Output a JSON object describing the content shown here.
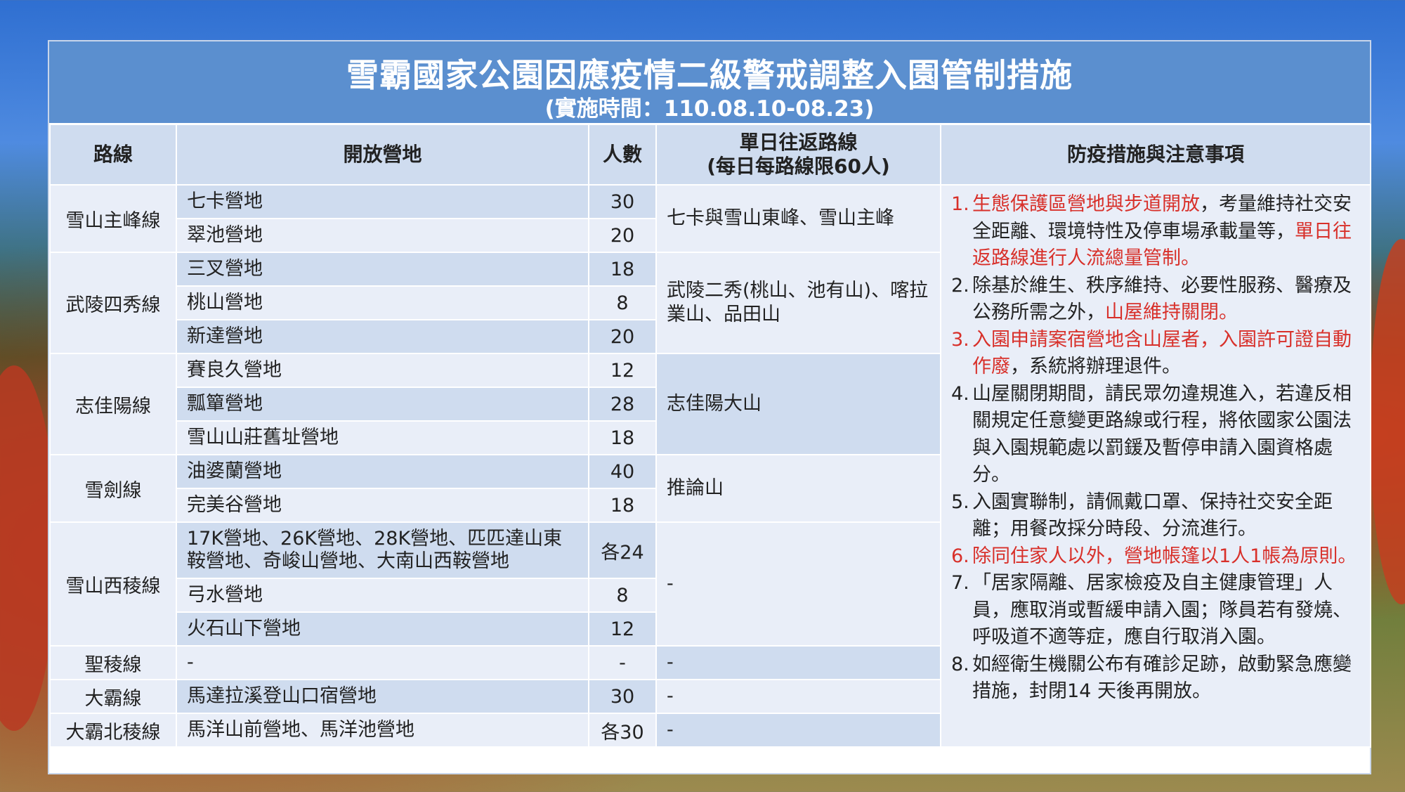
{
  "header": {
    "title": "雪霸國家公園因應疫情二級警戒調整入園管制措施",
    "subtitle": "(實施時間：110.08.10-08.23)"
  },
  "columns": {
    "route": "路線",
    "camp": "開放營地",
    "count": "人數",
    "trail_line1": "單日往返路線",
    "trail_line2": "(每日每路線限60人)",
    "notes": "防疫措施與注意事項"
  },
  "routes": [
    {
      "name": "雪山主峰線",
      "trail": "七卡與雪山東峰、雪山主峰",
      "camps": [
        {
          "name": "七卡營地",
          "count": "30"
        },
        {
          "name": "翠池營地",
          "count": "20"
        }
      ]
    },
    {
      "name": "武陵四秀線",
      "trail": "武陵二秀(桃山、池有山)、喀拉業山、品田山",
      "camps": [
        {
          "name": "三叉營地",
          "count": "18"
        },
        {
          "name": "桃山營地",
          "count": "8"
        },
        {
          "name": "新達營地",
          "count": "20"
        }
      ]
    },
    {
      "name": "志佳陽線",
      "trail": "志佳陽大山",
      "camps": [
        {
          "name": "賽良久營地",
          "count": "12"
        },
        {
          "name": "瓢簞營地",
          "count": "28"
        },
        {
          "name": "雪山山莊舊址營地",
          "count": "18"
        }
      ]
    },
    {
      "name": "雪劍線",
      "trail": "推論山",
      "camps": [
        {
          "name": "油婆蘭營地",
          "count": "40"
        },
        {
          "name": "完美谷營地",
          "count": "18"
        }
      ]
    },
    {
      "name": "雪山西稜線",
      "trail": "-",
      "camps": [
        {
          "name": "17K營地、26K營地、28K營地、匹匹達山東鞍營地、奇峻山營地、大南山西鞍營地",
          "count": "各24"
        },
        {
          "name": "弓水營地",
          "count": "8"
        },
        {
          "name": "火石山下營地",
          "count": "12"
        }
      ]
    },
    {
      "name": "聖稜線",
      "trail": "-",
      "camps": [
        {
          "name": "-",
          "count": "-"
        }
      ]
    },
    {
      "name": "大霸線",
      "trail": "-",
      "camps": [
        {
          "name": "馬達拉溪登山口宿營地",
          "count": "30"
        }
      ]
    },
    {
      "name": "大霸北稜線",
      "trail": "-",
      "camps": [
        {
          "name": "馬洋山前營地、馬洋池營地",
          "count": "各30"
        }
      ]
    }
  ],
  "notes": [
    {
      "num": "1.",
      "parts": [
        {
          "text": "生態保護區營地與步道開放",
          "red": true
        },
        {
          "text": "，考量維持社交安全距離、環境特性及停車場承載量等，",
          "red": false
        },
        {
          "text": "單日往返路線進行人流總量管制。",
          "red": true
        }
      ]
    },
    {
      "num": "2.",
      "parts": [
        {
          "text": "除基於維生、秩序維持、必要性服務、醫療及公務所需之外，",
          "red": false
        },
        {
          "text": "山屋維持關閉。",
          "red": true
        }
      ]
    },
    {
      "num": "3.",
      "parts": [
        {
          "text": "入園申請案宿營地含山屋者，入園許可證自動作廢",
          "red": true
        },
        {
          "text": "，系統將辦理退件。",
          "red": false
        }
      ]
    },
    {
      "num": "4.",
      "parts": [
        {
          "text": "山屋關閉期間，請民眾勿違規進入，若違反相關規定任意變更路線或行程，將依國家公園法與入園規範處以罰鍰及暫停申請入園資格處分。",
          "red": false
        }
      ]
    },
    {
      "num": "5.",
      "parts": [
        {
          "text": "入園實聯制，請佩戴口罩、保持社交安全距離；用餐改採分時段、分流進行。",
          "red": false
        }
      ]
    },
    {
      "num": "6.",
      "parts": [
        {
          "text": "除同住家人以外，營地帳篷以1人1帳為原則。",
          "red": true
        }
      ]
    },
    {
      "num": "7.",
      "parts": [
        {
          "text": "「居家隔離、居家檢疫及自主健康管理」人員，應取消或暫緩申請入園；隊員若有發燒、呼吸道不適等症，應自行取消入園。",
          "red": false
        }
      ]
    },
    {
      "num": "8.",
      "parts": [
        {
          "text": "如經衛生機關公布有確診足跡，啟動緊急應變措施，封閉14 天後再開放。",
          "red": false
        }
      ]
    }
  ]
}
